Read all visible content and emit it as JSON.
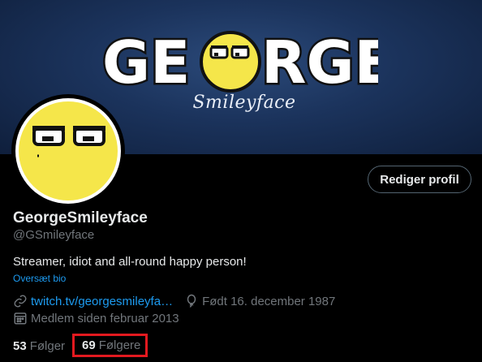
{
  "banner": {
    "logo_text": "GEORGE",
    "logo_subtext": "Smileyface"
  },
  "profile": {
    "edit_button_label": "Rediger profil",
    "display_name": "GeorgeSmileyface",
    "handle": "@GSmileyface",
    "bio": "Streamer, idiot and all-round happy person!",
    "translate_label": "Oversæt bio",
    "link_text": "twitch.tv/georgesmileyfa…",
    "birthdate": "Født 16. december 1987",
    "joined": "Medlem siden februar 2013"
  },
  "stats": {
    "following_count": "53",
    "following_label": "Følger",
    "followers_count": "69",
    "followers_label": "Følgere"
  },
  "icons": {
    "link": "link-icon",
    "birthday": "balloon-icon",
    "joined": "calendar-icon"
  },
  "colors": {
    "accent": "#1d9bf0",
    "highlight_box": "#e3191f",
    "smiley_yellow": "#f5e64a"
  }
}
